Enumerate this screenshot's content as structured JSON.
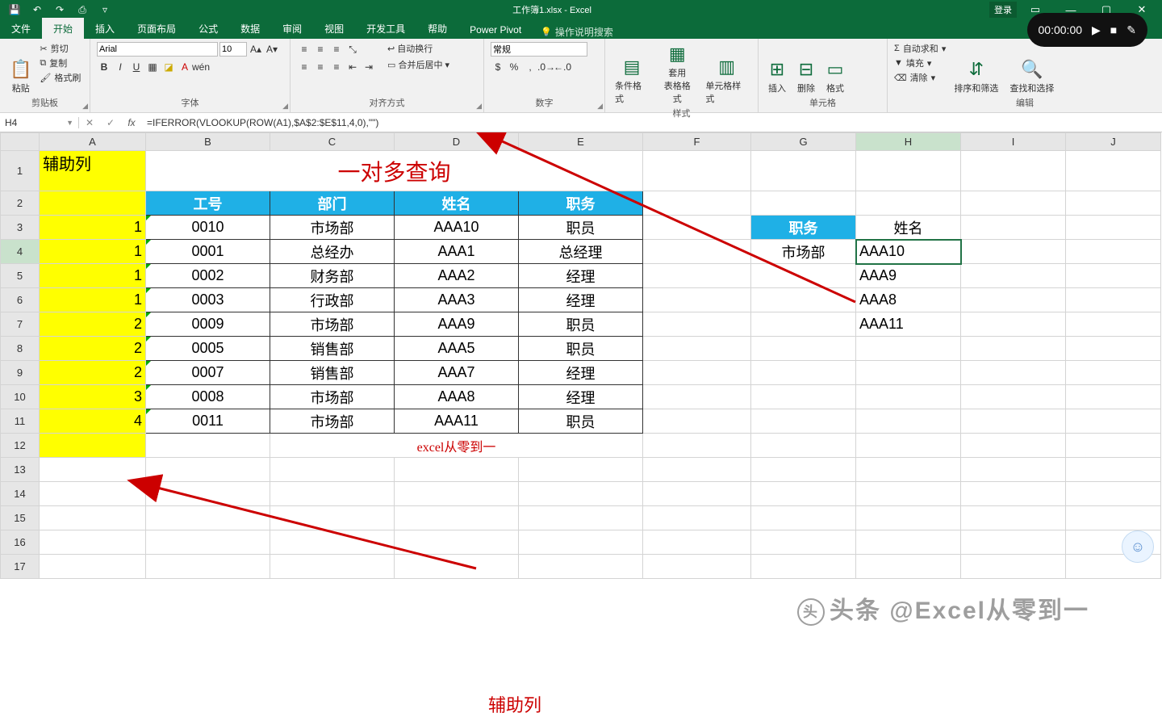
{
  "titlebar": {
    "title": "工作簿1.xlsx - Excel",
    "login": "登录"
  },
  "recorder": {
    "time": "00:00:00"
  },
  "menu": {
    "file": "文件",
    "home": "开始",
    "insert": "插入",
    "layout": "页面布局",
    "formulas": "公式",
    "data": "数据",
    "review": "审阅",
    "view": "视图",
    "dev": "开发工具",
    "help": "帮助",
    "pivot": "Power Pivot",
    "tell": "操作说明搜索"
  },
  "ribbon": {
    "clipboard": {
      "paste": "粘贴",
      "cut": "剪切",
      "copy": "复制",
      "painter": "格式刷",
      "label": "剪贴板"
    },
    "font": {
      "name": "Arial",
      "size": "10",
      "label": "字体"
    },
    "align": {
      "wrap": "自动换行",
      "merge": "合并后居中",
      "label": "对齐方式"
    },
    "number": {
      "style": "常规",
      "label": "数字"
    },
    "styles": {
      "cond": "条件格式",
      "table": "套用\n表格格式",
      "cell": "单元格样式",
      "label": "样式"
    },
    "cells": {
      "insert": "插入",
      "delete": "删除",
      "format": "格式",
      "label": "单元格"
    },
    "editing": {
      "sum": "自动求和",
      "fill": "填充",
      "clear": "清除",
      "sort": "排序和筛选",
      "find": "查找和选择",
      "label": "编辑"
    }
  },
  "fbar": {
    "cell": "H4",
    "formula": "=IFERROR(VLOOKUP(ROW(A1),$A$2:$E$11,4,0),\"\")"
  },
  "cols": [
    "A",
    "B",
    "C",
    "D",
    "E",
    "F",
    "G",
    "H",
    "I",
    "J"
  ],
  "rows": [
    "1",
    "2",
    "3",
    "4",
    "5",
    "6",
    "7",
    "8",
    "9",
    "10",
    "11",
    "12",
    "13",
    "14",
    "15",
    "16",
    "17"
  ],
  "sheet": {
    "a1": "辅助列",
    "title": "一对多查询",
    "hdr": {
      "b": "工号",
      "c": "部门",
      "d": "姓名",
      "e": "职务"
    },
    "aux": [
      "1",
      "1",
      "1",
      "1",
      "2",
      "2",
      "2",
      "3",
      "4"
    ],
    "rows": [
      {
        "b": "0010",
        "c": "市场部",
        "d": "AAA10",
        "e": "职员"
      },
      {
        "b": "0001",
        "c": "总经办",
        "d": "AAA1",
        "e": "总经理"
      },
      {
        "b": "0002",
        "c": "财务部",
        "d": "AAA2",
        "e": "经理"
      },
      {
        "b": "0003",
        "c": "行政部",
        "d": "AAA3",
        "e": "经理"
      },
      {
        "b": "0009",
        "c": "市场部",
        "d": "AAA9",
        "e": "职员"
      },
      {
        "b": "0005",
        "c": "销售部",
        "d": "AAA5",
        "e": "职员"
      },
      {
        "b": "0007",
        "c": "销售部",
        "d": "AAA7",
        "e": "经理"
      },
      {
        "b": "0008",
        "c": "市场部",
        "d": "AAA8",
        "e": "经理"
      },
      {
        "b": "0011",
        "c": "市场部",
        "d": "AAA11",
        "e": "职员"
      }
    ],
    "footer": "excel从零到一",
    "lookup": {
      "g3": "职务",
      "h3": "姓名",
      "g4": "市场部",
      "h": [
        "AAA10",
        "AAA9",
        "AAA8",
        "AAA11"
      ]
    }
  },
  "annot": {
    "aux": "辅助列"
  },
  "watermark": "头条 @Excel从零到一"
}
